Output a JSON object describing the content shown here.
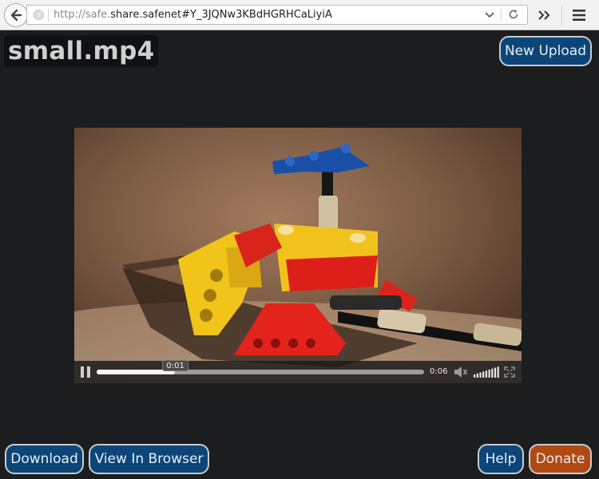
{
  "browser": {
    "url_prefix": "http://safe.",
    "url_host": "share.safenet",
    "url_rest": "#Y_3JQNw3KBdHGRHCaLiyiA"
  },
  "page": {
    "file_title": "small.mp4",
    "new_upload_label": "New Upload",
    "download_label": "Download",
    "view_in_browser_label": "View In Browser",
    "help_label": "Help",
    "donate_label": "Donate"
  },
  "player": {
    "current_time": "0:01",
    "duration": "0:06",
    "progress": 0.24,
    "volume_level": 1.0
  },
  "colors": {
    "page_bg": "#1c1d1f",
    "button_blue": "#0c4678",
    "button_orange": "#b14a12",
    "button_border": "#c8ccd0"
  }
}
